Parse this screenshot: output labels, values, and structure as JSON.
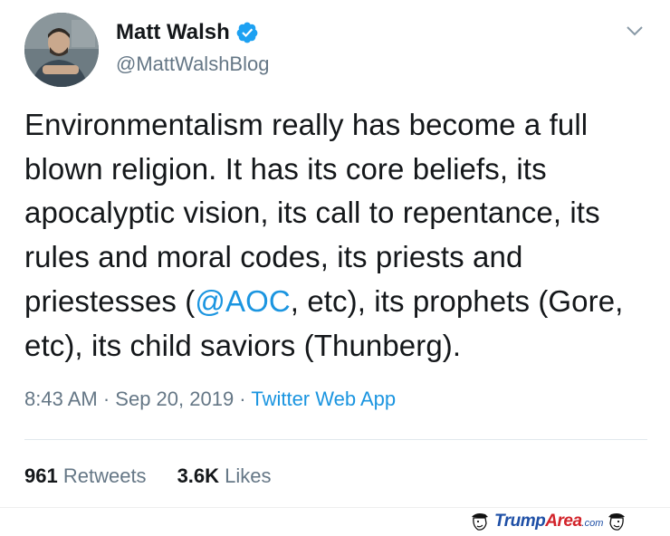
{
  "author": {
    "display_name": "Matt Walsh",
    "handle": "@MattWalshBlog",
    "verified_icon": "verified-badge-icon",
    "avatar_icon": "user-avatar-photo"
  },
  "tweet": {
    "text_part1": "Environmentalism really has become a full blown religion. It has its core beliefs, its apocalyptic vision, its call to repentance, its rules and moral codes, its priests and priestesses (",
    "mention": "@AOC",
    "text_part2": ", etc), its prophets (Gore, etc), its child saviors (Thunberg)."
  },
  "meta": {
    "time": "8:43 AM",
    "sep1": " · ",
    "date": "Sep 20, 2019",
    "sep2": " · ",
    "source": "Twitter Web App"
  },
  "stats": {
    "retweets_count": "961",
    "retweets_label": "Retweets",
    "likes_count": "3.6K",
    "likes_label": "Likes"
  },
  "watermark": {
    "part1": "Trump",
    "part2": "Area",
    "part3": ".com"
  },
  "colors": {
    "link_blue": "#1b95e0",
    "secondary_gray": "#657786",
    "primary_text": "#14171a",
    "watermark_blue": "#1e4fa6",
    "watermark_red": "#d2232a"
  }
}
